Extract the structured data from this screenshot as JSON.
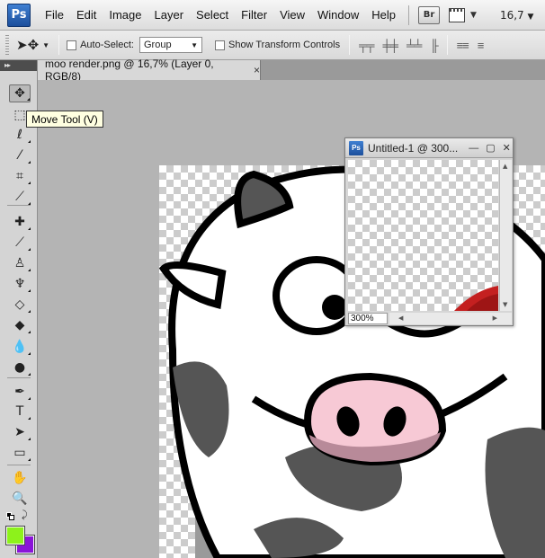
{
  "menubar": {
    "logo": "Ps",
    "items": [
      "File",
      "Edit",
      "Image",
      "Layer",
      "Select",
      "Filter",
      "View",
      "Window",
      "Help"
    ],
    "bridge_label": "Br",
    "zoom_value": "16,7"
  },
  "options": {
    "auto_select_label": "Auto-Select:",
    "auto_select_value": "Group",
    "show_transform_label": "Show Transform Controls"
  },
  "document": {
    "tab_title": "moo render.png @ 16,7% (Layer 0, RGB/8)",
    "tab_close": "×"
  },
  "tooltip": {
    "text": "Move Tool (V)"
  },
  "float_window": {
    "logo": "Ps",
    "title": "Untitled-1 @ 300...",
    "zoom": "300%"
  },
  "colors": {
    "foreground": "#8df21b",
    "background": "#8a14d8"
  },
  "tools": [
    {
      "name": "move-tool-icon",
      "glyph": "✥"
    },
    {
      "name": "marquee-tool-icon",
      "glyph": "⬚"
    },
    {
      "name": "lasso-tool-icon",
      "glyph": "ℓ"
    },
    {
      "name": "magic-wand-tool-icon",
      "glyph": "⁄"
    },
    {
      "name": "crop-tool-icon",
      "glyph": "⌗"
    },
    {
      "name": "eyedropper-tool-icon",
      "glyph": "⟋"
    },
    {
      "name": "healing-brush-tool-icon",
      "glyph": "✚"
    },
    {
      "name": "brush-tool-icon",
      "glyph": "⟋"
    },
    {
      "name": "clone-stamp-tool-icon",
      "glyph": "♙"
    },
    {
      "name": "history-brush-tool-icon",
      "glyph": "♆"
    },
    {
      "name": "eraser-tool-icon",
      "glyph": "◇"
    },
    {
      "name": "paint-bucket-tool-icon",
      "glyph": "◆"
    },
    {
      "name": "blur-tool-icon",
      "glyph": "💧"
    },
    {
      "name": "dodge-tool-icon",
      "glyph": "●"
    },
    {
      "name": "pen-tool-icon",
      "glyph": "✒"
    },
    {
      "name": "type-tool-icon",
      "glyph": "T"
    },
    {
      "name": "path-selection-tool-icon",
      "glyph": "➤"
    },
    {
      "name": "shape-tool-icon",
      "glyph": "▭"
    },
    {
      "name": "hand-tool-icon",
      "glyph": "✋"
    },
    {
      "name": "zoom-tool-icon",
      "glyph": "🔍"
    }
  ]
}
